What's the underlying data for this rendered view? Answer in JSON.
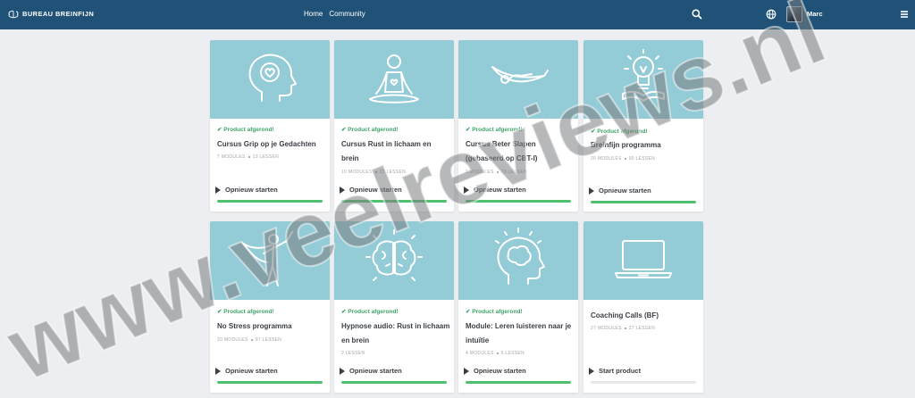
{
  "header": {
    "brand": "BUREAU BREINFIJN",
    "nav": [
      "Home",
      "Community"
    ],
    "user_name": "Marc",
    "icons": [
      "brain-logo-icon",
      "search-icon",
      "globe-icon",
      "hamburger-menu-icon"
    ]
  },
  "colors": {
    "header_bg": "#1f5276",
    "card_image_bg": "#93cbd6",
    "complete_green": "#3fa36a",
    "progress_green": "#4fc06d",
    "page_bg": "#eceef1"
  },
  "products": [
    {
      "title": "Cursus Grip op je Gedachten",
      "status": "Product afgerond!",
      "modules": "7 MODULES",
      "lessons": "13 LESSEN",
      "action": "Opnieuw starten",
      "progress": 1.0,
      "image": "head-heart-icon"
    },
    {
      "title": "Cursus Rust in lichaam en brein",
      "status": "Product afgerond!",
      "modules": "10 MODULES",
      "lessons": "22 LESSEN",
      "action": "Opnieuw starten",
      "progress": 1.0,
      "image": "meditation-icon"
    },
    {
      "title": "Cursus Beter Slapen (gebaseerd op CBT-I)",
      "status": "Product afgerond!",
      "modules": "9 MODULES",
      "lessons": "23 LESSEN",
      "action": "Opnieuw starten",
      "progress": 1.0,
      "image": "hammock-icon"
    },
    {
      "title": "Breinfijn programma",
      "status": "Product afgerond!",
      "modules": "20 MODULES",
      "lessons": "90 LESSEN",
      "action": "Opnieuw starten",
      "progress": 1.0,
      "image": "lightbulb-book-icon"
    },
    {
      "title": "No Stress programma",
      "status": "Product afgerond!",
      "modules": "20 MODULES",
      "lessons": "97 LESSEN",
      "action": "Opnieuw starten",
      "progress": 1.0,
      "image": "superhero-icon"
    },
    {
      "title": "Hypnose audio: Rust in lichaam en brein",
      "status": "Product afgerond!",
      "modules": "2 LESSEN",
      "lessons": "",
      "action": "Opnieuw starten",
      "progress": 1.0,
      "image": "brain-glow-icon"
    },
    {
      "title": "Module: Leren luisteren naar je intuïtie",
      "status": "Product afgerond!",
      "modules": "4 MODULES",
      "lessons": "5 LESSEN",
      "action": "Opnieuw starten",
      "progress": 1.0,
      "image": "head-brain-icon"
    },
    {
      "title": "Coaching Calls (BF)",
      "status": "",
      "modules": "27 MODULES",
      "lessons": "27 LESSEN",
      "action": "Start product",
      "progress": 0.0,
      "image": "laptop-icon"
    }
  ],
  "watermark": "www.veelreviews.nl"
}
